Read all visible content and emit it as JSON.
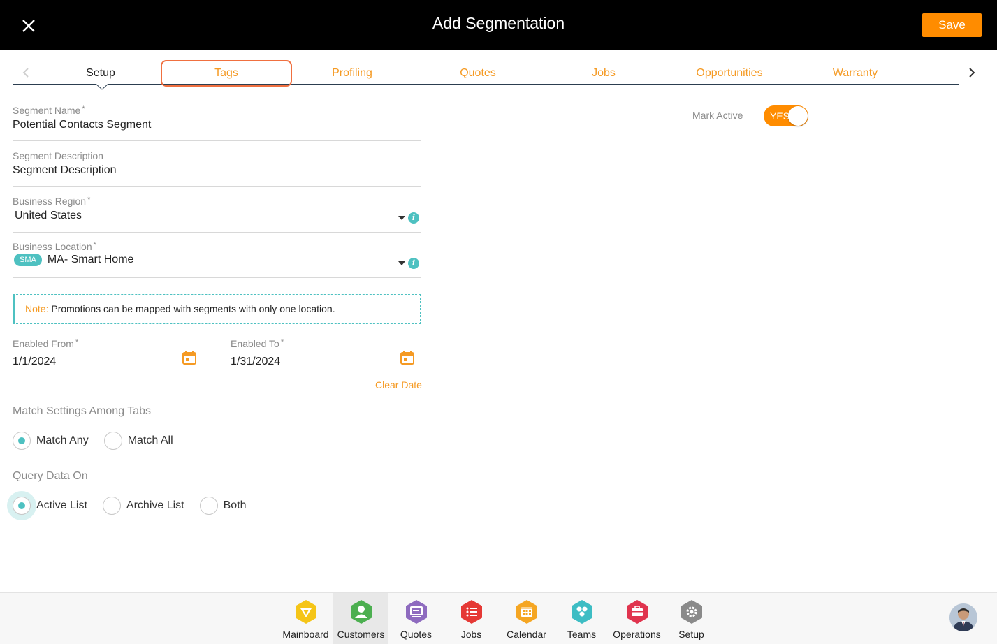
{
  "header": {
    "title": "Add Segmentation",
    "save_label": "Save"
  },
  "tabs": [
    {
      "label": "Setup",
      "active": true
    },
    {
      "label": "Tags"
    },
    {
      "label": "Profiling"
    },
    {
      "label": "Quotes"
    },
    {
      "label": "Jobs"
    },
    {
      "label": "Opportunities"
    },
    {
      "label": "Warranty"
    }
  ],
  "form": {
    "segment_name": {
      "label": "Segment Name",
      "required": "*",
      "value": "Potential Contacts Segment"
    },
    "segment_description": {
      "label": "Segment Description",
      "value": "Segment Description"
    },
    "business_region": {
      "label": "Business Region",
      "required": "*",
      "value": "United States"
    },
    "business_location": {
      "label": "Business Location",
      "required": "*",
      "badge": "SMA",
      "value": "MA- Smart Home"
    },
    "note": {
      "label": "Note:",
      "text": "Promotions can be mapped with segments with only one location."
    },
    "enabled_from": {
      "label": "Enabled From",
      "required": "*",
      "value": "1/1/2024"
    },
    "enabled_to": {
      "label": "Enabled To",
      "required": "*",
      "value": "1/31/2024"
    },
    "clear_date": "Clear Date",
    "match_settings": {
      "title": "Match Settings Among Tabs",
      "options": [
        "Match Any",
        "Match All"
      ],
      "selected": "Match Any"
    },
    "query_data": {
      "title": "Query Data On",
      "options": [
        "Active List",
        "Archive List",
        "Both"
      ],
      "selected": "Active List"
    }
  },
  "mark_active": {
    "label": "Mark Active",
    "toggle_text": "YES",
    "on": true
  },
  "bottom_nav": [
    {
      "label": "Mainboard",
      "icon": "mainboard-icon",
      "color": "#f5c518"
    },
    {
      "label": "Customers",
      "icon": "customers-icon",
      "color": "#4caf50",
      "active": true
    },
    {
      "label": "Quotes",
      "icon": "quotes-icon",
      "color": "#8e6bbf"
    },
    {
      "label": "Jobs",
      "icon": "jobs-icon",
      "color": "#e53935"
    },
    {
      "label": "Calendar",
      "icon": "calendar-icon",
      "color": "#f5a623"
    },
    {
      "label": "Teams",
      "icon": "teams-icon",
      "color": "#3dbdc4"
    },
    {
      "label": "Operations",
      "icon": "operations-icon",
      "color": "#e0344e"
    },
    {
      "label": "Setup",
      "icon": "setup-icon",
      "color": "#8a8a8a"
    }
  ],
  "colors": {
    "accent": "#ff8c00",
    "teal": "#4ec1c1",
    "header_bg": "#000000"
  }
}
